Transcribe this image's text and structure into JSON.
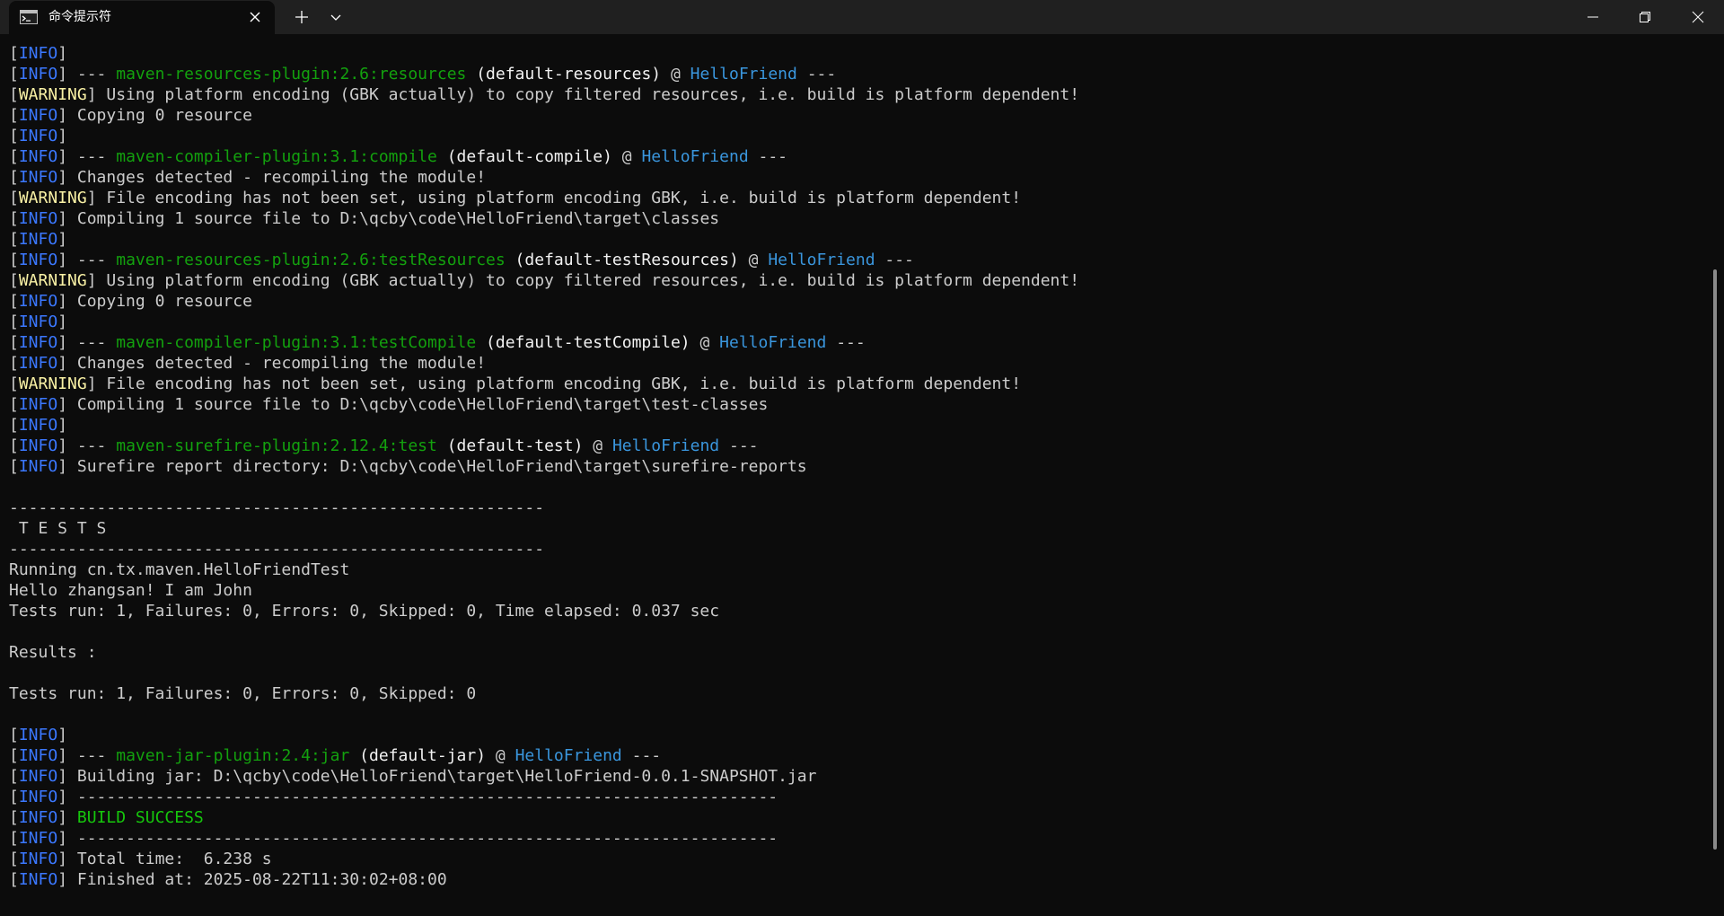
{
  "window": {
    "tab_title": "命令提示符",
    "tab_icon": "console-icon",
    "new_tab_icon": "plus-icon",
    "dropdown_icon": "chevron-down-icon",
    "controls": [
      "minimize-icon",
      "maximize-icon",
      "close-icon"
    ]
  },
  "colors": {
    "background": "#0c0c0c",
    "titlebar": "#202020",
    "info": "#3b78ff",
    "warning": "#f9f1a5",
    "plugin": "#13a10e",
    "project": "#3a96dd",
    "success": "#16c60c",
    "text": "#cccccc"
  },
  "console": {
    "lines": [
      [
        {
          "t": "[",
          "c": "default"
        },
        {
          "t": "INFO",
          "c": "info"
        },
        {
          "t": "]",
          "c": "default"
        }
      ],
      [
        {
          "t": "[",
          "c": "default"
        },
        {
          "t": "INFO",
          "c": "info"
        },
        {
          "t": "] --- ",
          "c": "default"
        },
        {
          "t": "maven-resources-plugin:2.6:resources",
          "c": "plugin"
        },
        {
          "t": " (default-resources)",
          "c": "bright"
        },
        {
          "t": " @ ",
          "c": "default"
        },
        {
          "t": "HelloFriend",
          "c": "project"
        },
        {
          "t": " ---",
          "c": "default"
        }
      ],
      [
        {
          "t": "[",
          "c": "default"
        },
        {
          "t": "WARNING",
          "c": "warn"
        },
        {
          "t": "] Using platform encoding (GBK actually) to copy filtered resources, i.e. build is platform dependent!",
          "c": "default"
        }
      ],
      [
        {
          "t": "[",
          "c": "default"
        },
        {
          "t": "INFO",
          "c": "info"
        },
        {
          "t": "] Copying 0 resource",
          "c": "default"
        }
      ],
      [
        {
          "t": "[",
          "c": "default"
        },
        {
          "t": "INFO",
          "c": "info"
        },
        {
          "t": "]",
          "c": "default"
        }
      ],
      [
        {
          "t": "[",
          "c": "default"
        },
        {
          "t": "INFO",
          "c": "info"
        },
        {
          "t": "] --- ",
          "c": "default"
        },
        {
          "t": "maven-compiler-plugin:3.1:compile",
          "c": "plugin"
        },
        {
          "t": " (default-compile)",
          "c": "bright"
        },
        {
          "t": " @ ",
          "c": "default"
        },
        {
          "t": "HelloFriend",
          "c": "project"
        },
        {
          "t": " ---",
          "c": "default"
        }
      ],
      [
        {
          "t": "[",
          "c": "default"
        },
        {
          "t": "INFO",
          "c": "info"
        },
        {
          "t": "] Changes detected - recompiling the module!",
          "c": "default"
        }
      ],
      [
        {
          "t": "[",
          "c": "default"
        },
        {
          "t": "WARNING",
          "c": "warn"
        },
        {
          "t": "] File encoding has not been set, using platform encoding GBK, i.e. build is platform dependent!",
          "c": "default"
        }
      ],
      [
        {
          "t": "[",
          "c": "default"
        },
        {
          "t": "INFO",
          "c": "info"
        },
        {
          "t": "] Compiling 1 source file to D:\\qcby\\code\\HelloFriend\\target\\classes",
          "c": "default"
        }
      ],
      [
        {
          "t": "[",
          "c": "default"
        },
        {
          "t": "INFO",
          "c": "info"
        },
        {
          "t": "]",
          "c": "default"
        }
      ],
      [
        {
          "t": "[",
          "c": "default"
        },
        {
          "t": "INFO",
          "c": "info"
        },
        {
          "t": "] --- ",
          "c": "default"
        },
        {
          "t": "maven-resources-plugin:2.6:testResources",
          "c": "plugin"
        },
        {
          "t": " (default-testResources)",
          "c": "bright"
        },
        {
          "t": " @ ",
          "c": "default"
        },
        {
          "t": "HelloFriend",
          "c": "project"
        },
        {
          "t": " ---",
          "c": "default"
        }
      ],
      [
        {
          "t": "[",
          "c": "default"
        },
        {
          "t": "WARNING",
          "c": "warn"
        },
        {
          "t": "] Using platform encoding (GBK actually) to copy filtered resources, i.e. build is platform dependent!",
          "c": "default"
        }
      ],
      [
        {
          "t": "[",
          "c": "default"
        },
        {
          "t": "INFO",
          "c": "info"
        },
        {
          "t": "] Copying 0 resource",
          "c": "default"
        }
      ],
      [
        {
          "t": "[",
          "c": "default"
        },
        {
          "t": "INFO",
          "c": "info"
        },
        {
          "t": "]",
          "c": "default"
        }
      ],
      [
        {
          "t": "[",
          "c": "default"
        },
        {
          "t": "INFO",
          "c": "info"
        },
        {
          "t": "] --- ",
          "c": "default"
        },
        {
          "t": "maven-compiler-plugin:3.1:testCompile",
          "c": "plugin"
        },
        {
          "t": " (default-testCompile)",
          "c": "bright"
        },
        {
          "t": " @ ",
          "c": "default"
        },
        {
          "t": "HelloFriend",
          "c": "project"
        },
        {
          "t": " ---",
          "c": "default"
        }
      ],
      [
        {
          "t": "[",
          "c": "default"
        },
        {
          "t": "INFO",
          "c": "info"
        },
        {
          "t": "] Changes detected - recompiling the module!",
          "c": "default"
        }
      ],
      [
        {
          "t": "[",
          "c": "default"
        },
        {
          "t": "WARNING",
          "c": "warn"
        },
        {
          "t": "] File encoding has not been set, using platform encoding GBK, i.e. build is platform dependent!",
          "c": "default"
        }
      ],
      [
        {
          "t": "[",
          "c": "default"
        },
        {
          "t": "INFO",
          "c": "info"
        },
        {
          "t": "] Compiling 1 source file to D:\\qcby\\code\\HelloFriend\\target\\test-classes",
          "c": "default"
        }
      ],
      [
        {
          "t": "[",
          "c": "default"
        },
        {
          "t": "INFO",
          "c": "info"
        },
        {
          "t": "]",
          "c": "default"
        }
      ],
      [
        {
          "t": "[",
          "c": "default"
        },
        {
          "t": "INFO",
          "c": "info"
        },
        {
          "t": "] --- ",
          "c": "default"
        },
        {
          "t": "maven-surefire-plugin:2.12.4:test",
          "c": "plugin"
        },
        {
          "t": " (default-test)",
          "c": "bright"
        },
        {
          "t": " @ ",
          "c": "default"
        },
        {
          "t": "HelloFriend",
          "c": "project"
        },
        {
          "t": " ---",
          "c": "default"
        }
      ],
      [
        {
          "t": "[",
          "c": "default"
        },
        {
          "t": "INFO",
          "c": "info"
        },
        {
          "t": "] Surefire report directory: D:\\qcby\\code\\HelloFriend\\target\\surefire-reports",
          "c": "default"
        }
      ],
      [],
      [
        {
          "t": "-------------------------------------------------------",
          "c": "default"
        }
      ],
      [
        {
          "t": " T E S T S",
          "c": "default"
        }
      ],
      [
        {
          "t": "-------------------------------------------------------",
          "c": "default"
        }
      ],
      [
        {
          "t": "Running cn.tx.maven.HelloFriendTest",
          "c": "default"
        }
      ],
      [
        {
          "t": "Hello zhangsan! I am John",
          "c": "default"
        }
      ],
      [
        {
          "t": "Tests run: 1, Failures: 0, Errors: 0, Skipped: 0, Time elapsed: 0.037 sec",
          "c": "default"
        }
      ],
      [],
      [
        {
          "t": "Results :",
          "c": "default"
        }
      ],
      [],
      [
        {
          "t": "Tests run: 1, Failures: 0, Errors: 0, Skipped: 0",
          "c": "default"
        }
      ],
      [],
      [
        {
          "t": "[",
          "c": "default"
        },
        {
          "t": "INFO",
          "c": "info"
        },
        {
          "t": "]",
          "c": "default"
        }
      ],
      [
        {
          "t": "[",
          "c": "default"
        },
        {
          "t": "INFO",
          "c": "info"
        },
        {
          "t": "] --- ",
          "c": "default"
        },
        {
          "t": "maven-jar-plugin:2.4:jar",
          "c": "plugin"
        },
        {
          "t": " (default-jar)",
          "c": "bright"
        },
        {
          "t": " @ ",
          "c": "default"
        },
        {
          "t": "HelloFriend",
          "c": "project"
        },
        {
          "t": " ---",
          "c": "default"
        }
      ],
      [
        {
          "t": "[",
          "c": "default"
        },
        {
          "t": "INFO",
          "c": "info"
        },
        {
          "t": "] Building jar: D:\\qcby\\code\\HelloFriend\\target\\HelloFriend-0.0.1-SNAPSHOT.jar",
          "c": "default"
        }
      ],
      [
        {
          "t": "[",
          "c": "default"
        },
        {
          "t": "INFO",
          "c": "info"
        },
        {
          "t": "] ------------------------------------------------------------------------",
          "c": "default"
        }
      ],
      [
        {
          "t": "[",
          "c": "default"
        },
        {
          "t": "INFO",
          "c": "info"
        },
        {
          "t": "] ",
          "c": "default"
        },
        {
          "t": "BUILD SUCCESS",
          "c": "success"
        }
      ],
      [
        {
          "t": "[",
          "c": "default"
        },
        {
          "t": "INFO",
          "c": "info"
        },
        {
          "t": "] ------------------------------------------------------------------------",
          "c": "default"
        }
      ],
      [
        {
          "t": "[",
          "c": "default"
        },
        {
          "t": "INFO",
          "c": "info"
        },
        {
          "t": "] Total time:  6.238 s",
          "c": "default"
        }
      ],
      [
        {
          "t": "[",
          "c": "default"
        },
        {
          "t": "INFO",
          "c": "info"
        },
        {
          "t": "] Finished at: 2025-08-22T11:30:02+08:00",
          "c": "default"
        }
      ]
    ]
  }
}
